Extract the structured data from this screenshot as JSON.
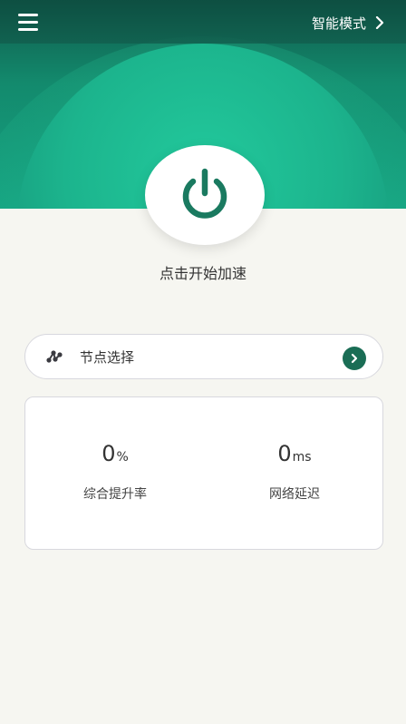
{
  "header": {
    "menu_icon": "hamburger-menu-icon",
    "mode_label": "智能模式",
    "mode_icon": "chevron-right-icon"
  },
  "main": {
    "power_icon": "power-icon",
    "start_label": "点击开始加速"
  },
  "node": {
    "icon": "node-graph-icon",
    "label": "节点选择",
    "arrow_icon": "chevron-right-circle-icon"
  },
  "stats": {
    "improvement": {
      "value": "0",
      "unit": "%",
      "label": "综合提升率"
    },
    "latency": {
      "value": "0",
      "unit": "ms",
      "label": "网络延迟"
    }
  },
  "colors": {
    "accent": "#1a7a60",
    "header_dark": "#0f5a4b",
    "header_light": "#22c99c"
  }
}
